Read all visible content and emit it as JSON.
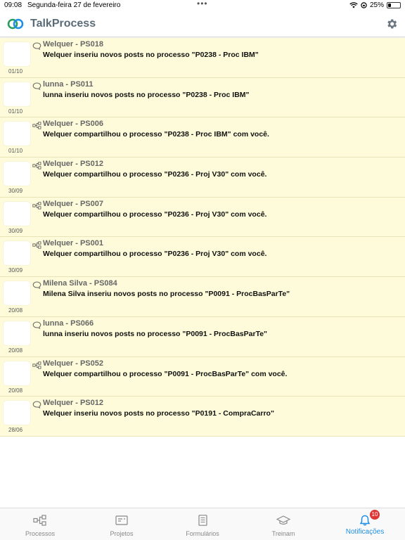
{
  "status_bar": {
    "time": "09:08",
    "date": "Segunda-feira 27 de fevereiro",
    "battery": "25%",
    "battery_level": 0.25
  },
  "header": {
    "title": "TalkProcess",
    "logo_colors": [
      "#2a9d5c",
      "#1e90e6"
    ]
  },
  "notifications": [
    {
      "title": "Welquer - PS018",
      "message": "Welquer inseriu novos posts no processo \"P0238 - Proc IBM\"",
      "date": "01/10",
      "type": "comment-icon"
    },
    {
      "title": "lunna - PS011",
      "message": "lunna inseriu novos posts no processo \"P0238 - Proc IBM\"",
      "date": "01/10",
      "type": "comment-icon"
    },
    {
      "title": "Welquer - PS006",
      "message": "Welquer compartilhou o processo \"P0238 - Proc IBM\" com você.",
      "date": "01/10",
      "type": "process-icon"
    },
    {
      "title": "Welquer - PS012",
      "message": "Welquer compartilhou o processo \"P0236 - Proj V30\" com você.",
      "date": "30/09",
      "type": "process-icon"
    },
    {
      "title": "Welquer - PS007",
      "message": "Welquer compartilhou o processo \"P0236 - Proj V30\" com você.",
      "date": "30/09",
      "type": "process-icon"
    },
    {
      "title": "Welquer - PS001",
      "message": "Welquer compartilhou o processo \"P0236 - Proj V30\" com você.",
      "date": "30/09",
      "type": "process-icon"
    },
    {
      "title": "Milena Silva - PS084",
      "message": "Milena Silva inseriu novos posts no processo \"P0091 - ProcBasParTe\"",
      "date": "20/08",
      "type": "comment-icon"
    },
    {
      "title": "lunna - PS066",
      "message": "lunna inseriu novos posts no processo \"P0091 - ProcBasParTe\"",
      "date": "20/08",
      "type": "comment-icon"
    },
    {
      "title": "Welquer - PS052",
      "message": "Welquer compartilhou o processo \"P0091 - ProcBasParTe\" com você.",
      "date": "20/08",
      "type": "process-icon"
    },
    {
      "title": "Welquer - PS012",
      "message": "Welquer inseriu novos posts no processo \"P0191 - CompraCarro\"",
      "date": "28/06",
      "type": "comment-icon"
    }
  ],
  "tabs": [
    {
      "label": "Processos",
      "icon": "process-icon"
    },
    {
      "label": "Projetos",
      "icon": "projects-icon"
    },
    {
      "label": "Formulários",
      "icon": "forms-icon"
    },
    {
      "label": "Treinam",
      "icon": "training-icon"
    },
    {
      "label": "Notificações",
      "icon": "bell-icon",
      "active": true,
      "badge": "10"
    }
  ],
  "colors": {
    "row_background": "#fdfbd9",
    "active_tab": "#1e90e6",
    "badge": "#e03535"
  }
}
